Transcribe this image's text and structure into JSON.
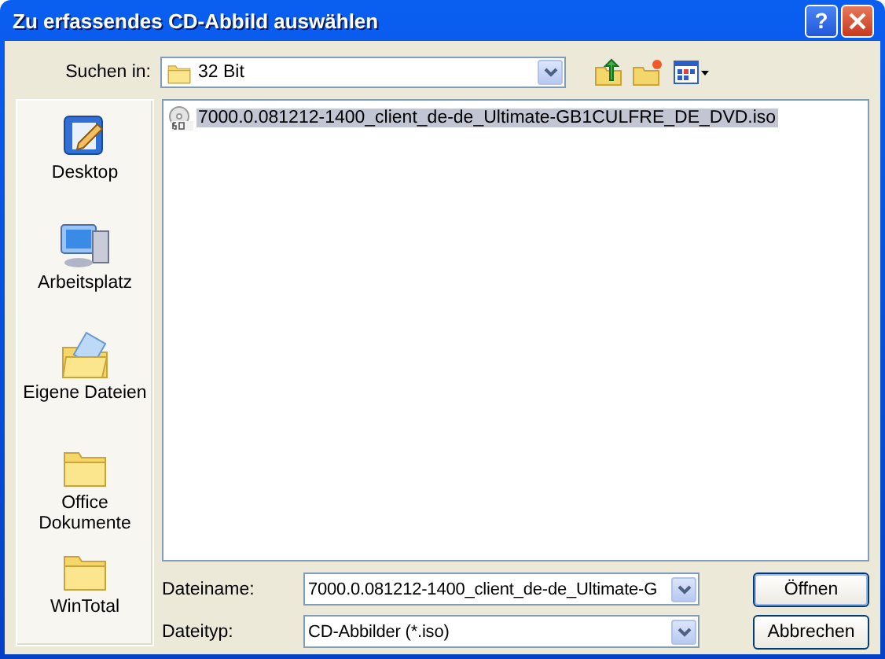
{
  "window": {
    "title": "Zu erfassendes CD-Abbild auswählen",
    "help_button": "?"
  },
  "look_in": {
    "label": "Suchen in:",
    "value": "32 Bit"
  },
  "places": [
    {
      "label": "Desktop",
      "kind": "desktop"
    },
    {
      "label": "Arbeitsplatz",
      "kind": "computer"
    },
    {
      "label": "Eigene Dateien",
      "kind": "documents"
    },
    {
      "label": "Office Dokumente",
      "kind": "folder"
    },
    {
      "label": "WinTotal",
      "kind": "folder"
    }
  ],
  "files": [
    {
      "name": "7000.0.081212-1400_client_de-de_Ultimate-GB1CULFRE_DE_DVD.iso",
      "selected": true
    }
  ],
  "filename": {
    "label": "Dateiname:",
    "value": "7000.0.081212-1400_client_de-de_Ultimate-G"
  },
  "filetype": {
    "label": "Dateityp:",
    "value": "CD-Abbilder (*.iso)"
  },
  "buttons": [
    "Öffnen",
    "Abbrechen"
  ]
}
